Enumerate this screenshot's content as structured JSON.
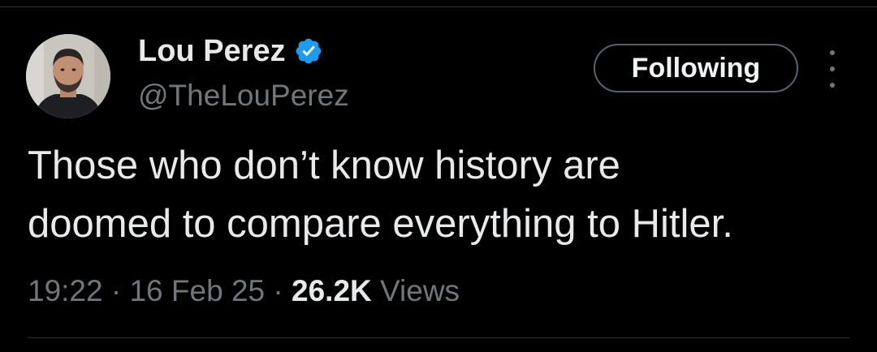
{
  "author": {
    "display_name": "Lou Perez",
    "handle": "@TheLouPerez",
    "verified_icon": "verified-badge-icon",
    "verified_color": "#1d9bf0"
  },
  "actions": {
    "follow_label": "Following",
    "more_icon": "more-options-icon"
  },
  "tweet": {
    "text_lines": [
      "Those who don’t know history are",
      "doomed to compare everything to Hitler."
    ]
  },
  "meta": {
    "time": "19:22",
    "separator": "·",
    "date": "16 Feb 25",
    "views_count": "26.2K",
    "views_label": "Views"
  },
  "colors": {
    "background": "#000000",
    "primary_text": "#e7e9ea",
    "secondary_text": "#71767b",
    "border": "#2f3336"
  }
}
